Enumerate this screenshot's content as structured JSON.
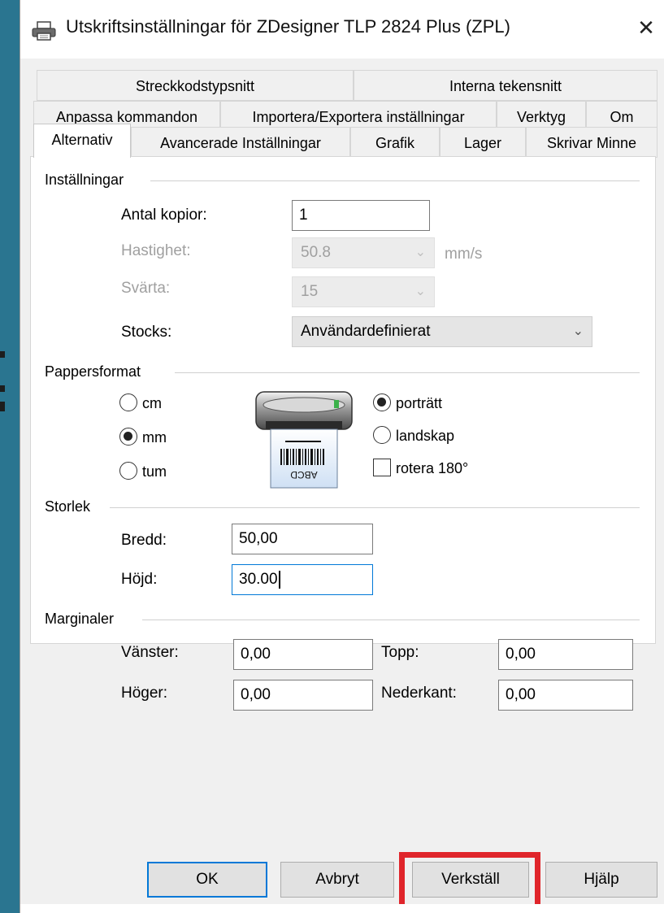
{
  "window": {
    "title": "Utskriftsinställningar för ZDesigner TLP 2824 Plus (ZPL)",
    "close": "✕"
  },
  "tabs": {
    "row1": [
      "Streckkodstypsnitt",
      "Interna tekensnitt"
    ],
    "row2": [
      "Anpassa kommandon",
      "Importera/Exportera inställningar",
      "Verktyg",
      "Om"
    ],
    "row3": [
      "Alternativ",
      "Avancerade Inställningar",
      "Grafik",
      "Lager",
      "Skrivar Minne"
    ],
    "active": "Alternativ"
  },
  "settings": {
    "group": "Inställningar",
    "copies_label": "Antal kopior:",
    "copies_value": "1",
    "speed_label": "Hastighet:",
    "speed_value": "50.8",
    "speed_unit": "mm/s",
    "darkness_label": "Svärta:",
    "darkness_value": "15",
    "stocks_label": "Stocks:",
    "stocks_value": "Användardefinierat"
  },
  "paper": {
    "group": "Pappersformat",
    "units": [
      "cm",
      "mm",
      "tum"
    ],
    "selected_unit": "mm",
    "orientation": [
      "porträtt",
      "landskap"
    ],
    "selected_orientation": "porträtt",
    "rotate_label": "rotera 180°",
    "rotate_checked": false,
    "label_text": "ABCD"
  },
  "size": {
    "group": "Storlek",
    "width_label": "Bredd:",
    "width_value": "50,00",
    "height_label": "Höjd:",
    "height_value": "30.00"
  },
  "margins": {
    "group": "Marginaler",
    "left_label": "Vänster:",
    "left_value": "0,00",
    "top_label": "Topp:",
    "top_value": "0,00",
    "right_label": "Höger:",
    "right_value": "0,00",
    "bottom_label": "Nederkant:",
    "bottom_value": "0,00"
  },
  "buttons": {
    "ok": "OK",
    "cancel": "Avbryt",
    "apply": "Verkställ",
    "help": "Hjälp"
  },
  "colors": {
    "accent": "#0078d7",
    "highlight": "#e0252b",
    "desktop": "#2e7a94"
  }
}
